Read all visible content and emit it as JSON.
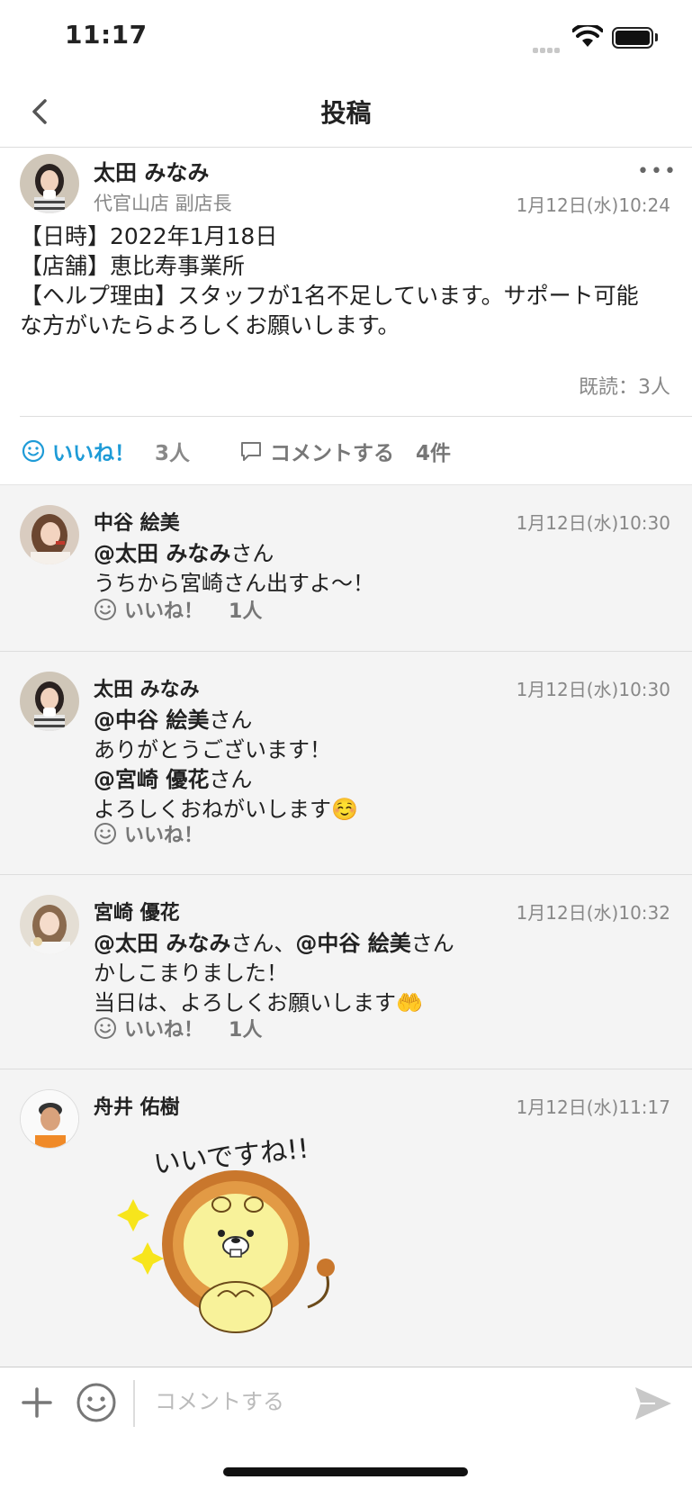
{
  "status_bar": {
    "time": "11:17"
  },
  "nav": {
    "title": "投稿"
  },
  "post": {
    "author": "太田 みなみ",
    "role": "代官山店 副店長",
    "timestamp": "1月12日(水)10:24",
    "body_lines": [
      "【日時】2022年1月18日",
      "【店舗】恵比寿事業所",
      "【ヘルプ理由】スタッフが1名不足しています。サポート可能",
      "な方がいたらよろしくお願いします。"
    ],
    "read_count": "既読：3人",
    "like_label": "いいね！",
    "like_count": "3人",
    "comment_label": "コメントする",
    "comment_count": "4件"
  },
  "comments": [
    {
      "name": "中谷 絵美",
      "timestamp": "1月12日(水)10:30",
      "mention1": "@太田 みなみ",
      "suffix1": "さん",
      "line2": "うちから宮崎さん出すよ〜！",
      "like_label": "いいね！",
      "like_count": "1人"
    },
    {
      "name": "太田 みなみ",
      "timestamp": "1月12日(水)10:30",
      "mention1": "@中谷 絵美",
      "suffix1": "さん",
      "line2": "ありがとうございます！",
      "mention2": "@宮崎 優花",
      "suffix2": "さん",
      "line4": "よろしくおねがいします☺️",
      "like_label": "いいね！"
    },
    {
      "name": "宮崎 優花",
      "timestamp": "1月12日(水)10:32",
      "mention1": "@太田 みなみ",
      "mid": "さん、",
      "mention2": "@中谷 絵美",
      "suffix2": "さん",
      "line2": "かしこまりました！",
      "line3": "当日は、よろしくお願いします🤲",
      "like_label": "いいね！",
      "like_count": "1人"
    },
    {
      "name": "舟井 佑樹",
      "timestamp": "1月12日(水)11:17",
      "sticker_text": "いいですね!!"
    }
  ],
  "input": {
    "placeholder": "コメントする"
  },
  "colors": {
    "accent": "#1e9bd7",
    "comments_bg": "#f4f4f4"
  }
}
